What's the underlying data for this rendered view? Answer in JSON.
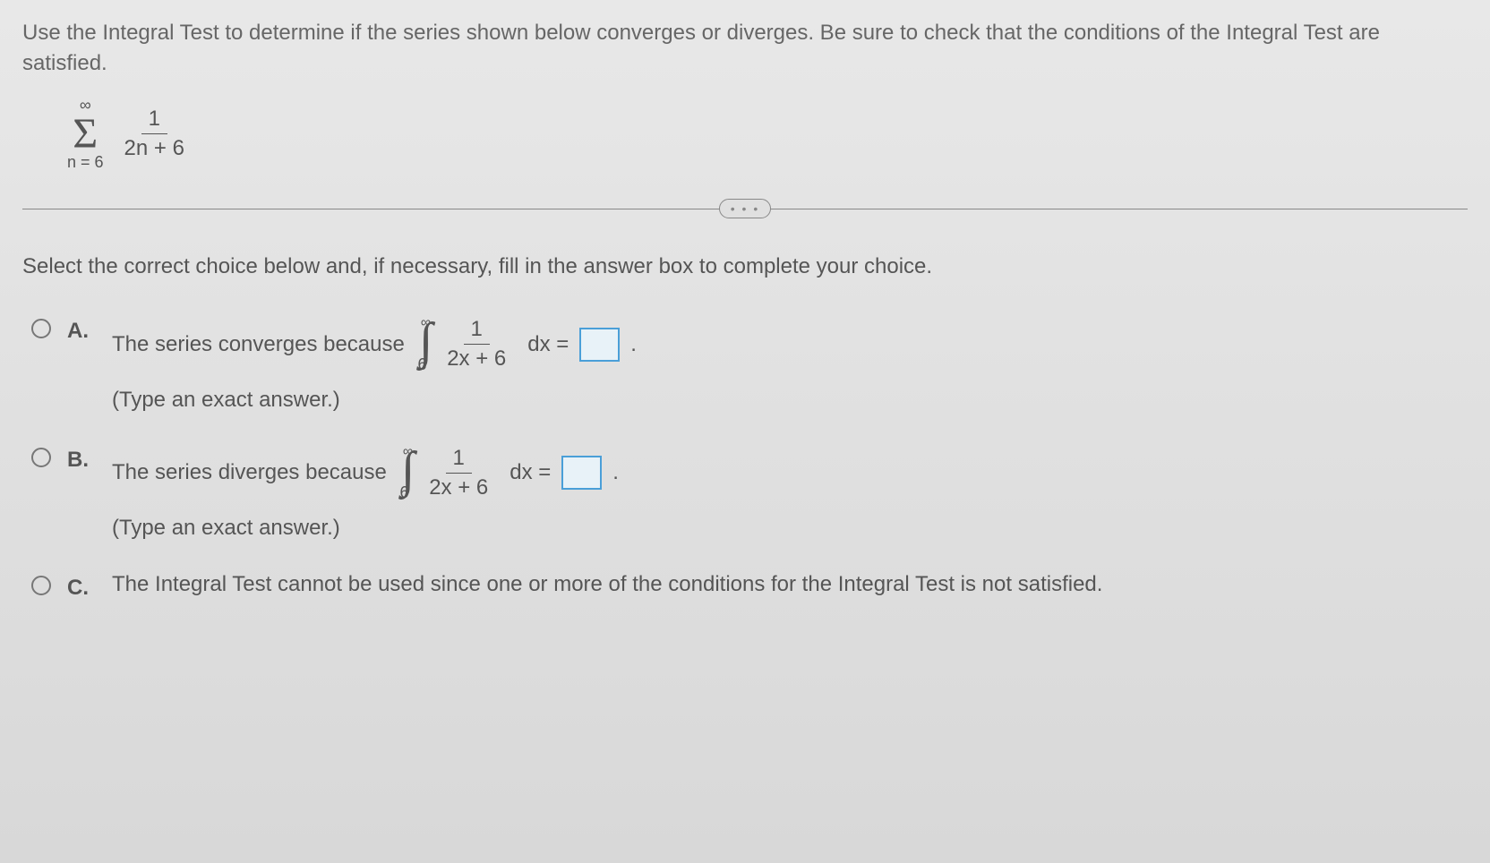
{
  "question": {
    "text": "Use the Integral Test to determine if the series shown below converges or diverges. Be sure to check that the conditions of the Integral Test are satisfied.",
    "series": {
      "upper": "∞",
      "lower": "n = 6",
      "numerator": "1",
      "denominator": "2n + 6"
    }
  },
  "divider": "• • •",
  "instruction": "Select the correct choice below and, if necessary, fill in the answer box to complete your choice.",
  "choices": {
    "a": {
      "label": "A.",
      "text": "The series converges because",
      "integral": {
        "upper": "∞",
        "lower": "6",
        "numerator": "1",
        "denominator": "2x + 6",
        "after": "dx ="
      },
      "period": ".",
      "hint": "(Type an exact answer.)"
    },
    "b": {
      "label": "B.",
      "text": "The series diverges because",
      "integral": {
        "upper": "∞",
        "lower": "6",
        "numerator": "1",
        "denominator": "2x + 6",
        "after": "dx ="
      },
      "period": ".",
      "hint": "(Type an exact answer.)"
    },
    "c": {
      "label": "C.",
      "text": "The Integral Test cannot be used since one or more of the conditions for the Integral Test is not satisfied."
    }
  }
}
